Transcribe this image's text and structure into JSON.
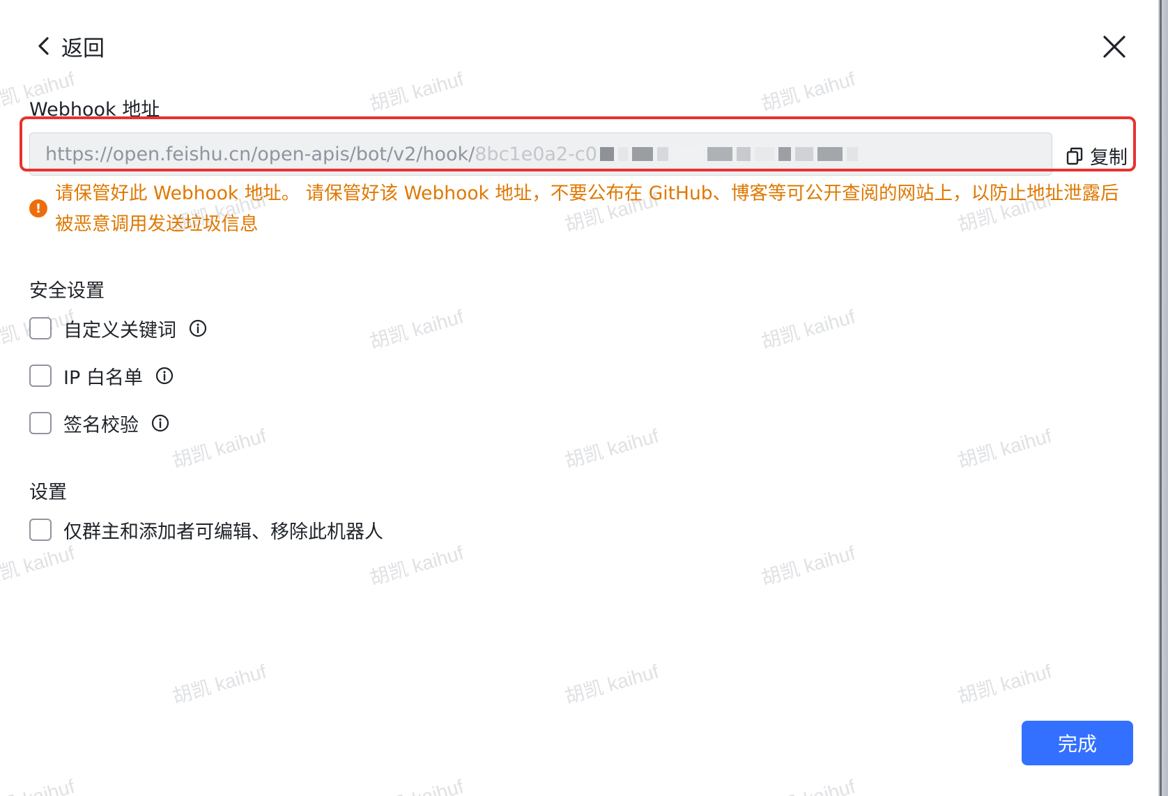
{
  "header": {
    "back_label": "返回",
    "back_icon": "chevron-left-icon",
    "close_icon": "close-icon"
  },
  "webhook": {
    "section_title": "Webhook 地址",
    "url_visible": "https://open.feishu.cn/open-apis/bot/v2/hook/",
    "url_partial": "8bc1e0a2-c0",
    "copy_label": "复制",
    "copy_icon": "copy-icon"
  },
  "warning": {
    "icon": "warning-icon",
    "text": "请保管好此 Webhook 地址。 请保管好该 Webhook 地址，不要公布在 GitHub、博客等可公开查阅的网站上，以防止地址泄露后被恶意调用发送垃圾信息"
  },
  "security": {
    "section_title": "安全设置",
    "options": [
      {
        "label": "自定义关键词",
        "checked": false,
        "has_info": true
      },
      {
        "label": "IP 白名单",
        "checked": false,
        "has_info": true
      },
      {
        "label": "签名校验",
        "checked": false,
        "has_info": true
      }
    ]
  },
  "settings": {
    "section_title": "设置",
    "options": [
      {
        "label": "仅群主和添加者可编辑、移除此机器人",
        "checked": false
      }
    ]
  },
  "footer": {
    "done_label": "完成"
  },
  "watermark": {
    "text": "胡凯 kaihuf"
  },
  "colors": {
    "primary": "#3370ff",
    "warning": "#de7802",
    "warning_icon": "#ed6d0c",
    "highlight_border": "#e8322f",
    "text": "#1f2329",
    "muted": "#8f959e",
    "input_bg": "#eef0f2"
  }
}
